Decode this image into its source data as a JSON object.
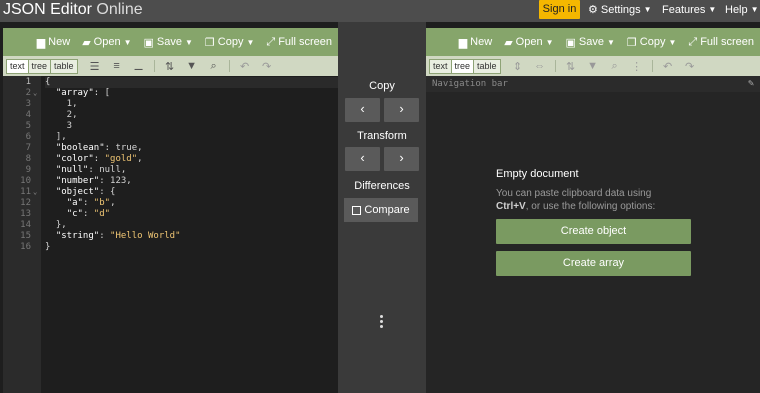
{
  "topbar": {
    "brand_main": "JSON Editor",
    "brand_sub": " Online",
    "signin_label": "Sign in",
    "settings_label": "Settings",
    "features_label": "Features",
    "help_label": "Help"
  },
  "left_menu": {
    "new_label": "New",
    "open_label": "Open",
    "save_label": "Save",
    "copy_label": "Copy",
    "fullscreen_label": "Full screen"
  },
  "right_menu": {
    "new_label": "New",
    "open_label": "Open",
    "save_label": "Save",
    "copy_label": "Copy",
    "fullscreen_label": "Full screen"
  },
  "left_modes": {
    "text": "text",
    "tree": "tree",
    "table": "table",
    "active": "text"
  },
  "right_modes": {
    "text": "text",
    "tree": "tree",
    "table": "table",
    "active": "tree"
  },
  "code_lines": [
    "{",
    "  \"array\": [",
    "    1,",
    "    2,",
    "    3",
    "  ],",
    "  \"boolean\": true,",
    "  \"color\": \"gold\",",
    "  \"null\": null,",
    "  \"number\": 123,",
    "  \"object\": {",
    "    \"a\": \"b\",",
    "    \"c\": \"d\"",
    "  },",
    "  \"string\": \"Hello World\"",
    "}"
  ],
  "middle": {
    "copy_label": "Copy",
    "transform_label": "Transform",
    "differences_label": "Differences",
    "compare_label": "Compare"
  },
  "right_panel": {
    "navbar_label": "Navigation bar",
    "empty_title": "Empty document",
    "empty_msg_1": "You can paste clipboard data using",
    "empty_msg_bold": "Ctrl+V",
    "empty_msg_2": ", or use the following options:",
    "create_object_label": "Create object",
    "create_array_label": "Create array"
  },
  "colors": {
    "menubar": "#86a56b",
    "toolbar": "#d0d8c2",
    "signin": "#f5b700",
    "create_button": "#7a9a61"
  }
}
